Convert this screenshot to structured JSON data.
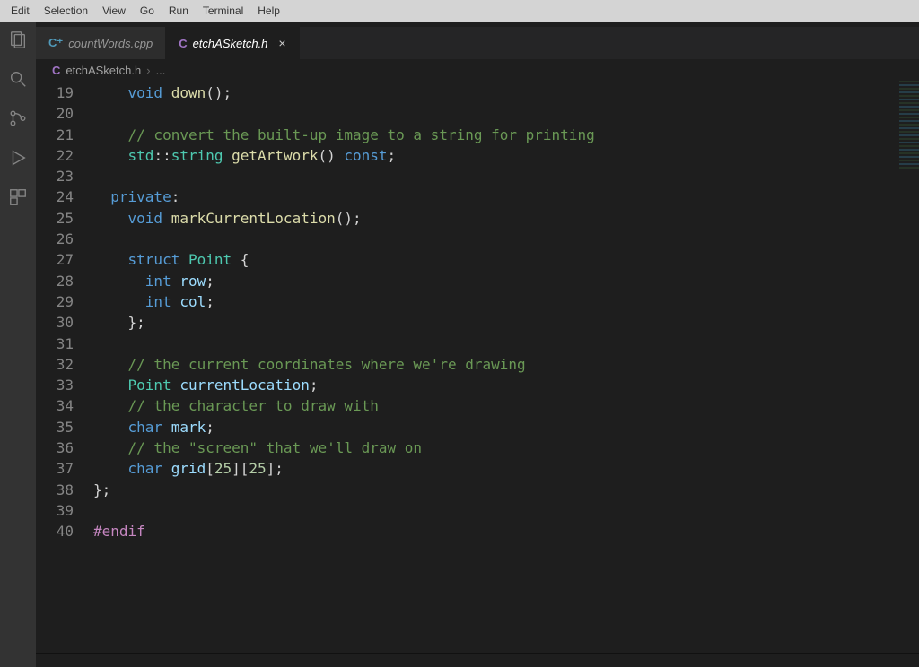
{
  "menu": {
    "items": [
      "Edit",
      "Selection",
      "View",
      "Go",
      "Run",
      "Terminal",
      "Help"
    ]
  },
  "tabs": [
    {
      "langBadge": "C⁺",
      "title": "countWords.cpp",
      "active": false,
      "close": ""
    },
    {
      "langBadge": "C",
      "title": "etchASketch.h",
      "active": true,
      "close": "×"
    }
  ],
  "breadcrumb": {
    "langBadge": "C",
    "file": "etchASketch.h",
    "sep": "›",
    "rest": "..."
  },
  "editor": {
    "startLine": 19,
    "lines": [
      [
        {
          "cls": "",
          "txt": "    "
        },
        {
          "cls": "tok-kw",
          "txt": "void"
        },
        {
          "cls": "",
          "txt": " "
        },
        {
          "cls": "tok-func",
          "txt": "down"
        },
        {
          "cls": "tok-punct",
          "txt": "();"
        }
      ],
      [
        {
          "cls": "",
          "txt": ""
        }
      ],
      [
        {
          "cls": "",
          "txt": "    "
        },
        {
          "cls": "tok-comment",
          "txt": "// convert the built-up image to a string for printing"
        }
      ],
      [
        {
          "cls": "",
          "txt": "    "
        },
        {
          "cls": "tok-ns",
          "txt": "std"
        },
        {
          "cls": "tok-punct",
          "txt": "::"
        },
        {
          "cls": "tok-type",
          "txt": "string"
        },
        {
          "cls": "",
          "txt": " "
        },
        {
          "cls": "tok-func",
          "txt": "getArtwork"
        },
        {
          "cls": "tok-punct",
          "txt": "()"
        },
        {
          "cls": "",
          "txt": " "
        },
        {
          "cls": "tok-kw",
          "txt": "const"
        },
        {
          "cls": "tok-punct",
          "txt": ";"
        }
      ],
      [
        {
          "cls": "",
          "txt": ""
        }
      ],
      [
        {
          "cls": "",
          "txt": "  "
        },
        {
          "cls": "tok-kw",
          "txt": "private"
        },
        {
          "cls": "tok-punct",
          "txt": ":"
        }
      ],
      [
        {
          "cls": "",
          "txt": "    "
        },
        {
          "cls": "tok-kw",
          "txt": "void"
        },
        {
          "cls": "",
          "txt": " "
        },
        {
          "cls": "tok-func",
          "txt": "markCurrentLocation"
        },
        {
          "cls": "tok-punct",
          "txt": "();"
        }
      ],
      [
        {
          "cls": "",
          "txt": ""
        }
      ],
      [
        {
          "cls": "",
          "txt": "    "
        },
        {
          "cls": "tok-kw",
          "txt": "struct"
        },
        {
          "cls": "",
          "txt": " "
        },
        {
          "cls": "tok-type",
          "txt": "Point"
        },
        {
          "cls": "",
          "txt": " "
        },
        {
          "cls": "tok-punct",
          "txt": "{"
        }
      ],
      [
        {
          "cls": "",
          "txt": "      "
        },
        {
          "cls": "tok-kw",
          "txt": "int"
        },
        {
          "cls": "",
          "txt": " "
        },
        {
          "cls": "tok-var",
          "txt": "row"
        },
        {
          "cls": "tok-punct",
          "txt": ";"
        }
      ],
      [
        {
          "cls": "",
          "txt": "      "
        },
        {
          "cls": "tok-kw",
          "txt": "int"
        },
        {
          "cls": "",
          "txt": " "
        },
        {
          "cls": "tok-var",
          "txt": "col"
        },
        {
          "cls": "tok-punct",
          "txt": ";"
        }
      ],
      [
        {
          "cls": "",
          "txt": "    "
        },
        {
          "cls": "tok-punct",
          "txt": "};"
        }
      ],
      [
        {
          "cls": "",
          "txt": ""
        }
      ],
      [
        {
          "cls": "",
          "txt": "    "
        },
        {
          "cls": "tok-comment",
          "txt": "// the current coordinates where we're drawing"
        }
      ],
      [
        {
          "cls": "",
          "txt": "    "
        },
        {
          "cls": "tok-type",
          "txt": "Point"
        },
        {
          "cls": "",
          "txt": " "
        },
        {
          "cls": "tok-var",
          "txt": "currentLocation"
        },
        {
          "cls": "tok-punct",
          "txt": ";"
        }
      ],
      [
        {
          "cls": "",
          "txt": "    "
        },
        {
          "cls": "tok-comment",
          "txt": "// the character to draw with"
        }
      ],
      [
        {
          "cls": "",
          "txt": "    "
        },
        {
          "cls": "tok-kw",
          "txt": "char"
        },
        {
          "cls": "",
          "txt": " "
        },
        {
          "cls": "tok-var",
          "txt": "mark"
        },
        {
          "cls": "tok-punct",
          "txt": ";"
        }
      ],
      [
        {
          "cls": "",
          "txt": "    "
        },
        {
          "cls": "tok-comment",
          "txt": "// the \"screen\" that we'll draw on"
        }
      ],
      [
        {
          "cls": "",
          "txt": "    "
        },
        {
          "cls": "tok-kw",
          "txt": "char"
        },
        {
          "cls": "",
          "txt": " "
        },
        {
          "cls": "tok-var",
          "txt": "grid"
        },
        {
          "cls": "tok-punct",
          "txt": "["
        },
        {
          "cls": "tok-num",
          "txt": "25"
        },
        {
          "cls": "tok-punct",
          "txt": "]["
        },
        {
          "cls": "tok-num",
          "txt": "25"
        },
        {
          "cls": "tok-punct",
          "txt": "];"
        }
      ],
      [
        {
          "cls": "tok-punct",
          "txt": "};"
        }
      ],
      [
        {
          "cls": "",
          "txt": ""
        }
      ],
      [
        {
          "cls": "tok-pre",
          "txt": "#endif"
        }
      ]
    ]
  }
}
